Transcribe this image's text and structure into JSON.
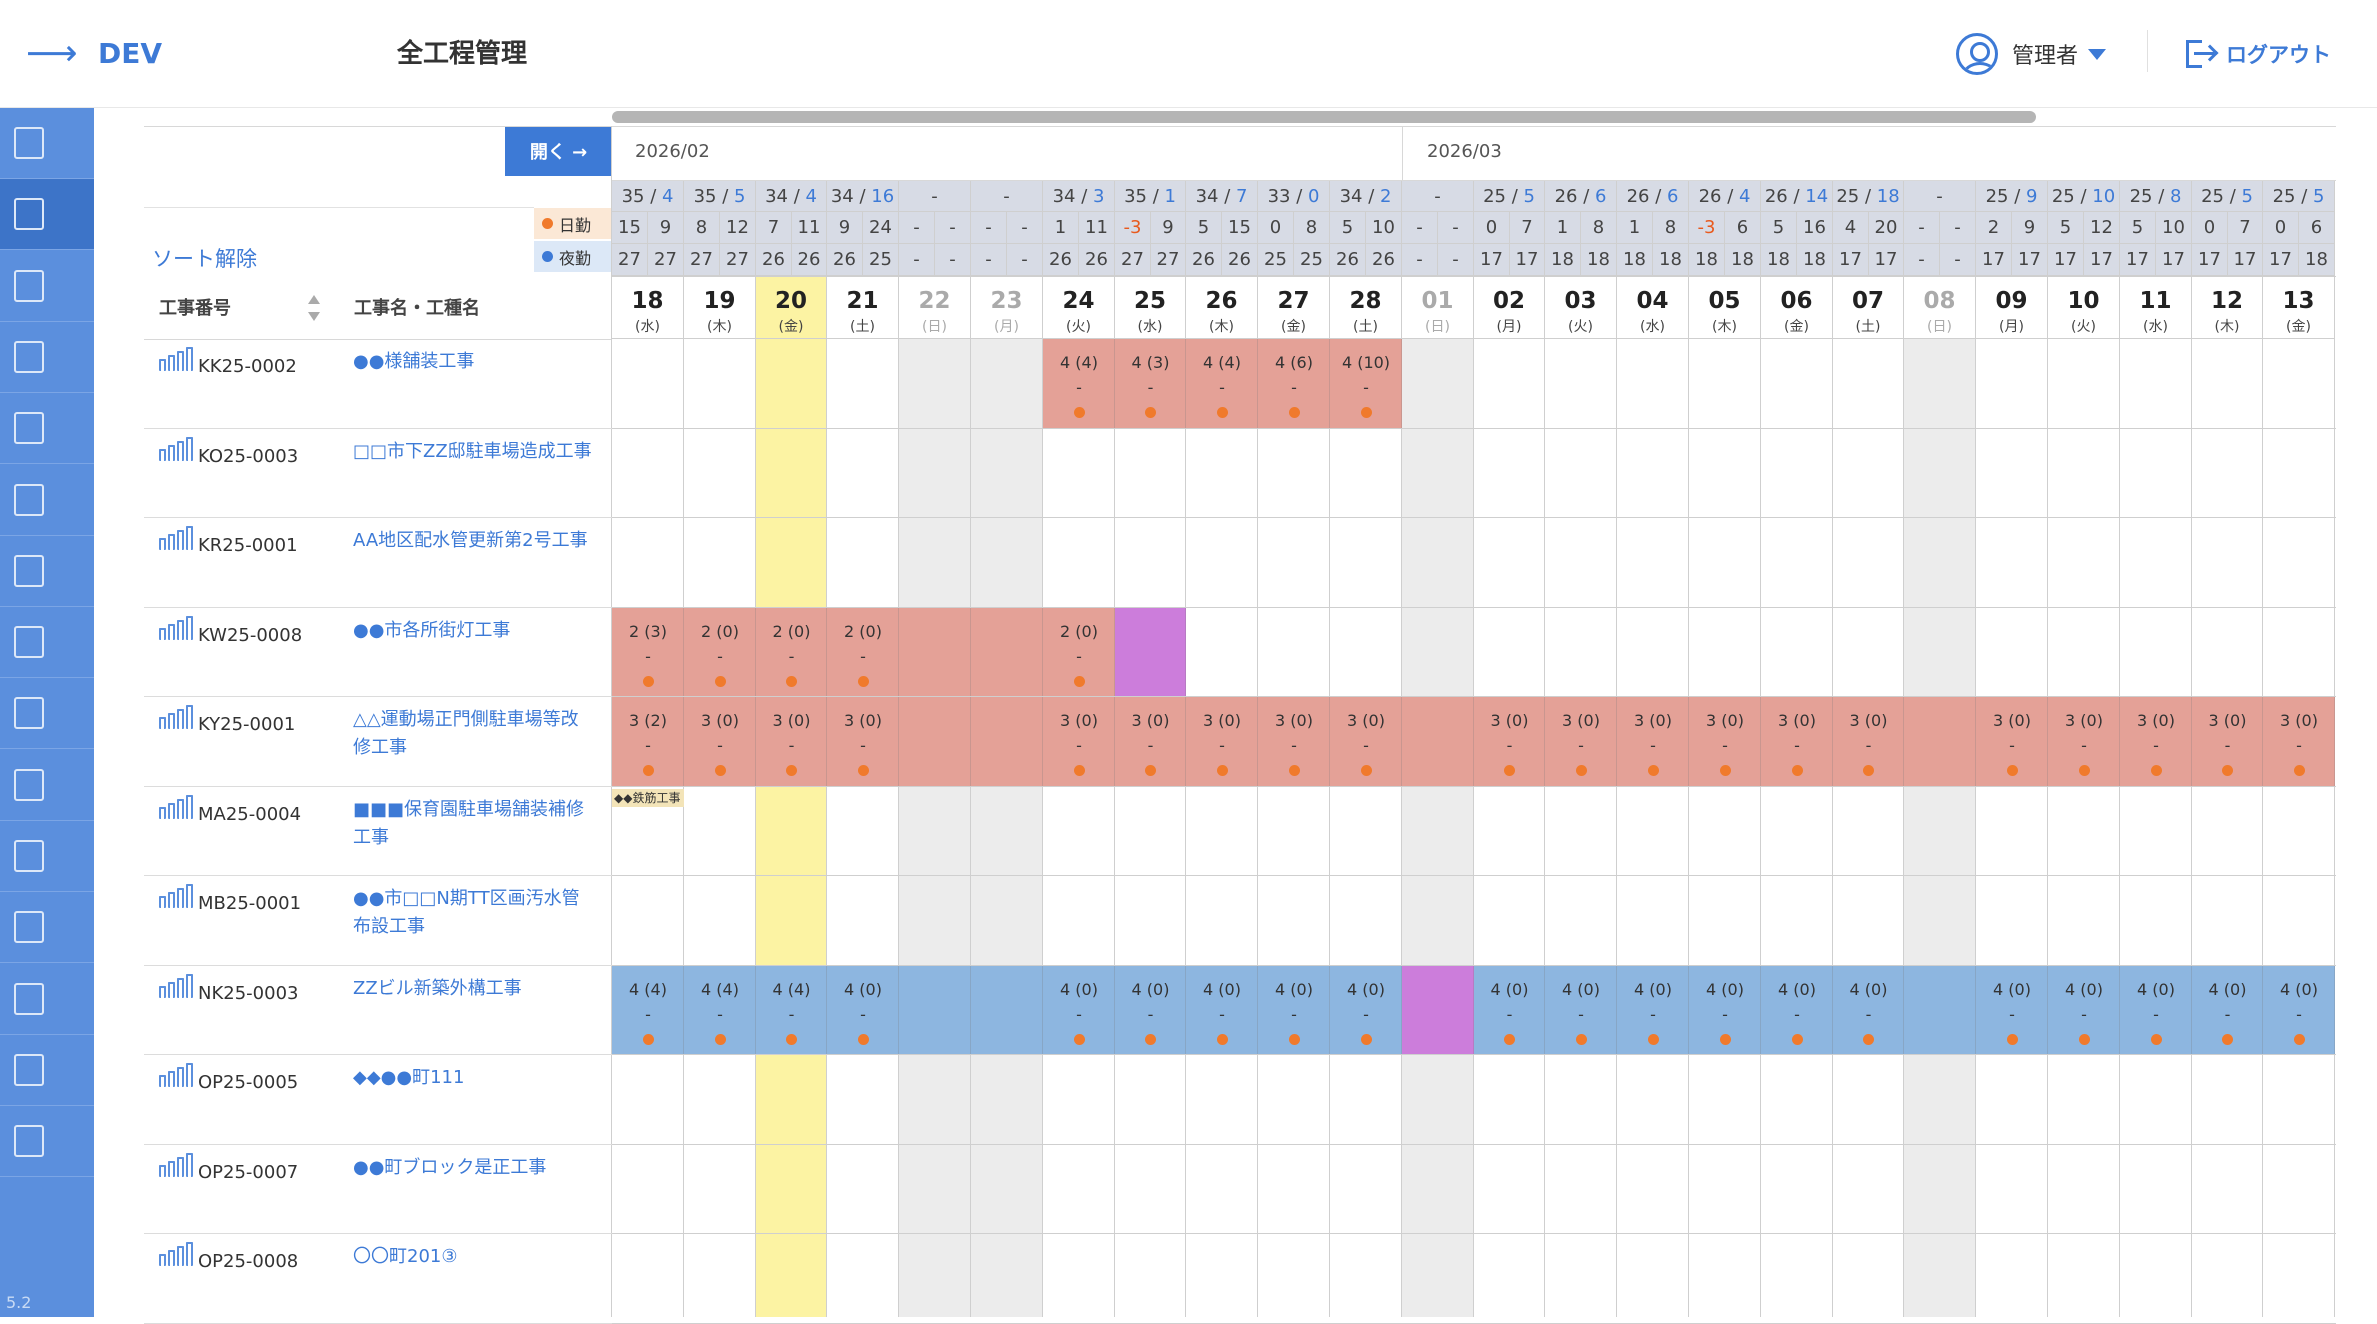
{
  "header": {
    "arrow": "⟶",
    "app": "DEV",
    "title": "全工程管理",
    "user": "管理者",
    "logout": "ログアウト"
  },
  "sidebar": {
    "version": "5.2",
    "icons": [
      "list-icon",
      "gantt-icon",
      "monitor-icon",
      "document-icon",
      "bar-chart-icon",
      "calendar-grid-icon",
      "user-icon",
      "truck-icon",
      "building-icon",
      "table-icon",
      "person-card-icon",
      "image-card-icon",
      "map-pin-icon",
      "clipboard-icon",
      "yen-icon"
    ]
  },
  "toolbar": {
    "open_label": "開く →",
    "sort_clear": "ソート解除",
    "legend_day": "日勤",
    "legend_night": "夜勤",
    "col_code": "工事番号",
    "col_name": "工事名・工種名"
  },
  "months": [
    "2026/02",
    "2026/03"
  ],
  "colors": {
    "blue": "#3d7ad6",
    "sidebar": "#5b8fdd",
    "pink": "#e4a197",
    "purple": "#cc7ddb",
    "bluebar": "#8db6e0",
    "today": "#fcf3a3",
    "holiday": "#ececec"
  },
  "dates": [
    {
      "d": "18",
      "w": "(水)"
    },
    {
      "d": "19",
      "w": "(木)"
    },
    {
      "d": "20",
      "w": "(金)",
      "today": true
    },
    {
      "d": "21",
      "w": "(土)"
    },
    {
      "d": "22",
      "w": "(日)",
      "hol": true
    },
    {
      "d": "23",
      "w": "(月)",
      "hol": true
    },
    {
      "d": "24",
      "w": "(火)"
    },
    {
      "d": "25",
      "w": "(水)"
    },
    {
      "d": "26",
      "w": "(木)"
    },
    {
      "d": "27",
      "w": "(金)"
    },
    {
      "d": "28",
      "w": "(土)"
    },
    {
      "d": "01",
      "w": "(日)",
      "hol": true
    },
    {
      "d": "02",
      "w": "(月)"
    },
    {
      "d": "03",
      "w": "(火)"
    },
    {
      "d": "04",
      "w": "(水)"
    },
    {
      "d": "05",
      "w": "(木)"
    },
    {
      "d": "06",
      "w": "(金)"
    },
    {
      "d": "07",
      "w": "(土)"
    },
    {
      "d": "08",
      "w": "(日)",
      "hol": true
    },
    {
      "d": "09",
      "w": "(月)"
    },
    {
      "d": "10",
      "w": "(火)"
    },
    {
      "d": "11",
      "w": "(水)"
    },
    {
      "d": "12",
      "w": "(木)"
    },
    {
      "d": "13",
      "w": "(金)"
    }
  ],
  "stats": {
    "top": [
      [
        "35",
        "4"
      ],
      [
        "35",
        "5"
      ],
      [
        "34",
        "4"
      ],
      [
        "34",
        "16"
      ],
      [
        "-",
        ""
      ],
      [
        "-",
        ""
      ],
      [
        "34",
        "3"
      ],
      [
        "35",
        "1"
      ],
      [
        "34",
        "7"
      ],
      [
        "33",
        "0"
      ],
      [
        "34",
        "2"
      ],
      [
        "-",
        ""
      ],
      [
        "25",
        "5"
      ],
      [
        "26",
        "6"
      ],
      [
        "26",
        "6"
      ],
      [
        "26",
        "4"
      ],
      [
        "26",
        "14"
      ],
      [
        "25",
        "18"
      ],
      [
        "-",
        ""
      ],
      [
        "25",
        "9"
      ],
      [
        "25",
        "10"
      ],
      [
        "25",
        "8"
      ],
      [
        "25",
        "5"
      ],
      [
        "25",
        "5"
      ]
    ],
    "day": [
      "15",
      "9",
      "8",
      "12",
      "7",
      "11",
      "9",
      "24",
      "-",
      "-",
      "-",
      "-",
      "1",
      "11",
      "-3",
      "9",
      "5",
      "15",
      "0",
      "8",
      "5",
      "10",
      "-",
      "-",
      "0",
      "7",
      "1",
      "8",
      "1",
      "8",
      "-3",
      "6",
      "5",
      "16",
      "4",
      "20",
      "-",
      "-",
      "2",
      "9",
      "5",
      "12",
      "5",
      "10",
      "0",
      "7",
      "0",
      "6"
    ],
    "night": [
      "27",
      "27",
      "27",
      "27",
      "26",
      "26",
      "26",
      "25",
      "-",
      "-",
      "-",
      "-",
      "26",
      "26",
      "27",
      "27",
      "26",
      "26",
      "25",
      "25",
      "26",
      "26",
      "-",
      "-",
      "17",
      "17",
      "18",
      "18",
      "18",
      "18",
      "18",
      "18",
      "18",
      "18",
      "17",
      "17",
      "-",
      "-",
      "17",
      "17",
      "17",
      "17",
      "17",
      "17",
      "17",
      "17",
      "17",
      "18"
    ]
  },
  "rows": [
    {
      "code": "KK25-0002",
      "name": "●●様舗装工事"
    },
    {
      "code": "KO25-0003",
      "name": "□□市下ZZ邸駐車場造成工事"
    },
    {
      "code": "KR25-0001",
      "name": "AA地区配水管更新第2号工事"
    },
    {
      "code": "KW25-0008",
      "name": "●●市各所街灯工事"
    },
    {
      "code": "KY25-0001",
      "name": "△△運動場正門側駐車場等改修工事"
    },
    {
      "code": "MA25-0004",
      "name": "■■■保育園駐車場舗装補修工事"
    },
    {
      "code": "MB25-0001",
      "name": "●●市□□N期TT区画汚水管布設工事"
    },
    {
      "code": "NK25-0003",
      "name": "ZZビル新築外構工事"
    },
    {
      "code": "OP25-0005",
      "name": "◆◆●●町111"
    },
    {
      "code": "OP25-0007",
      "name": "●●町ブロック是正工事"
    },
    {
      "code": "OP25-0008",
      "name": "〇〇町201③"
    }
  ],
  "bars": [
    {
      "row": 0,
      "start": 6,
      "end": 10,
      "color": "pink",
      "labels": {
        "6": "4 (4)",
        "7": "4 (3)",
        "8": "4 (4)",
        "9": "4 (6)",
        "10": "4 (10)"
      }
    },
    {
      "row": 3,
      "start": 0,
      "end": 6,
      "color": "pink",
      "labels": {
        "0": "2 (3)",
        "1": "2 (0)",
        "2": "2 (0)",
        "3": "2 (0)",
        "6": "2 (0)"
      }
    },
    {
      "row": 3,
      "start": 7,
      "end": 7,
      "color": "purple",
      "labels": {}
    },
    {
      "row": 4,
      "start": 0,
      "end": 23,
      "color": "pink",
      "labels": {
        "0": "3 (2)",
        "1": "3 (0)",
        "2": "3 (0)",
        "3": "3 (0)",
        "6": "3 (0)",
        "7": "3 (0)",
        "8": "3 (0)",
        "9": "3 (0)",
        "10": "3 (0)",
        "12": "3 (0)",
        "13": "3 (0)",
        "14": "3 (0)",
        "15": "3 (0)",
        "16": "3 (0)",
        "17": "3 (0)",
        "19": "3 (0)",
        "20": "3 (0)",
        "21": "3 (0)",
        "22": "3 (0)",
        "23": "3 (0)"
      }
    },
    {
      "row": 7,
      "start": 0,
      "end": 10,
      "color": "bluebar",
      "labels": {
        "0": "4 (4)",
        "1": "4 (4)",
        "2": "4 (4)",
        "3": "4 (0)",
        "6": "4 (0)",
        "7": "4 (0)",
        "8": "4 (0)",
        "9": "4 (0)",
        "10": "4 (0)"
      }
    },
    {
      "row": 7,
      "start": 11,
      "end": 11,
      "color": "purple",
      "labels": {}
    },
    {
      "row": 7,
      "start": 12,
      "end": 23,
      "color": "bluebar",
      "labels": {
        "12": "4 (0)",
        "13": "4 (0)",
        "14": "4 (0)",
        "15": "4 (0)",
        "16": "4 (0)",
        "17": "4 (0)",
        "19": "4 (0)",
        "20": "4 (0)",
        "21": "4 (0)",
        "22": "4 (0)",
        "23": "4 (0)"
      }
    }
  ],
  "bar_mark": "-",
  "mini_tag": "◆◆鉄筋工事"
}
